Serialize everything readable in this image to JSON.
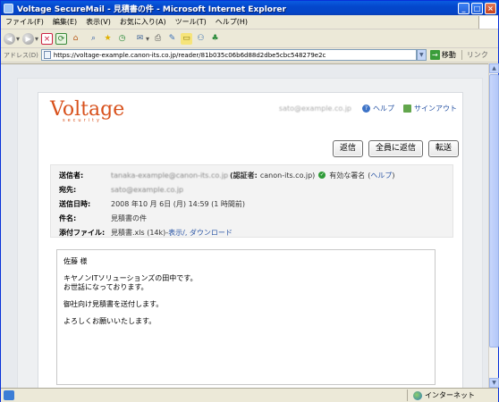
{
  "window": {
    "title": "Voltage SecureMail - 見積書の件 - Microsoft Internet Explorer",
    "minimize": "_",
    "maximize": "□",
    "close": "×"
  },
  "menu": [
    "ファイル(F)",
    "編集(E)",
    "表示(V)",
    "お気に入り(A)",
    "ツール(T)",
    "ヘルプ(H)"
  ],
  "toolbar": {
    "back_icon": "back-arrow-icon",
    "forward_icon": "forward-arrow-icon",
    "stop": "×",
    "refresh": "⟳",
    "home": "⌂",
    "search": "⌕",
    "favorites": "★",
    "history": "◷",
    "mail": "✉",
    "print": "⎙",
    "edit": "✎",
    "discuss": "▭",
    "research": "⚇",
    "messenger": "♣"
  },
  "address": {
    "label": "アドレス(D)",
    "url": "https://voltage-example.canon-its.co.jp/reader/81b035c06b6d88d2dbe5cbc548279e2c",
    "dropdown": "▼",
    "go": "移動",
    "go_arrow": "→",
    "links": "リンク"
  },
  "mail": {
    "logo": "Voltage",
    "logo_sub": "security",
    "user": "sato@example.co.jp",
    "help_icon_glyph": "?",
    "help": "ヘルプ",
    "signout": "サインアウト",
    "buttons": {
      "reply": "返信",
      "reply_all": "全員に返信",
      "forward": "転送"
    },
    "headers": {
      "from_label": "送信者:",
      "from_value": "tanaka-example@canon-its.co.jp",
      "cert_label": "(認証者:",
      "cert_value": "canon-its.co.jp)",
      "sig_check": "✓",
      "signature": "有効な署名",
      "sig_help_open": "(",
      "sig_help": "ヘルプ",
      "sig_help_close": ")",
      "to_label": "宛先:",
      "to_value": "sato@example.co.jp",
      "date_label": "送信日時:",
      "date_value": "2008 年10 月 6日 (月) 14:59 (1 時間前)",
      "subject_label": "件名:",
      "subject_value": "見積書の件",
      "attach_label": "添付ファイル:",
      "attach_file": "見積書.xls (14k)",
      "attach_sep": " - ",
      "attach_actions": "表示/, ダウンロード"
    },
    "body": [
      "佐藤 様",
      "",
      "キヤノンITソリューションズの田中です。",
      "お世話になっております。",
      "",
      "御社向け見積書を送付します。",
      "",
      "よろしくお願いいたします。"
    ]
  },
  "status": {
    "zone": "インターネット"
  }
}
